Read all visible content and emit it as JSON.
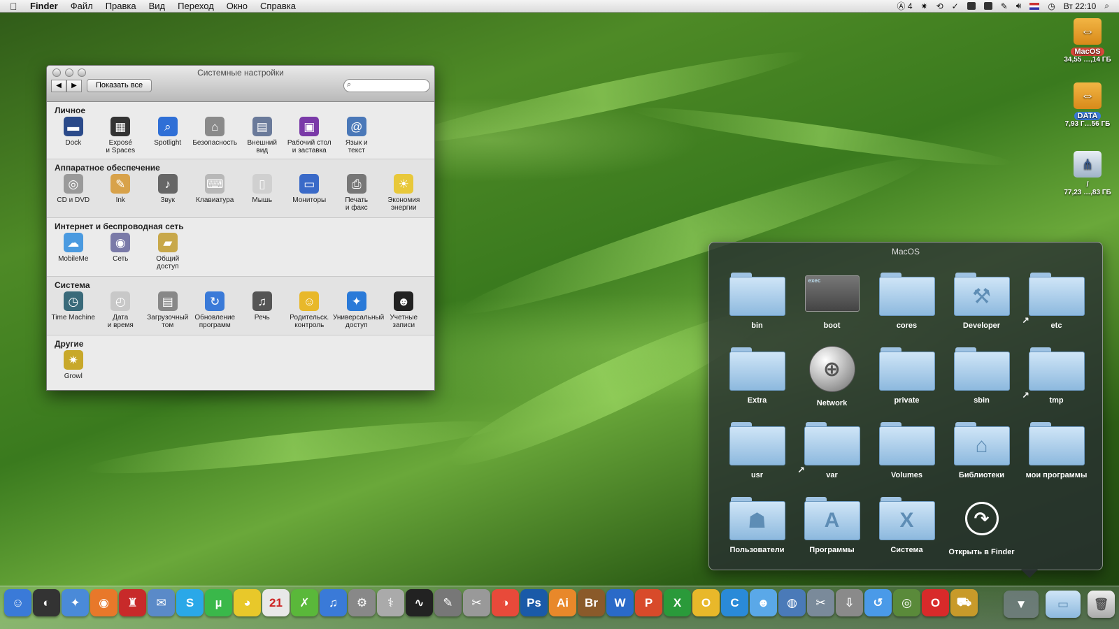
{
  "menubar": {
    "app": "Finder",
    "items": [
      "Файл",
      "Правка",
      "Вид",
      "Переход",
      "Окно",
      "Справка"
    ],
    "status_text": "4",
    "clock": "Вт 22:10"
  },
  "prefs": {
    "title": "Системные настройки",
    "show_all": "Показать все",
    "sections": [
      {
        "title": "Личное",
        "items": [
          {
            "label": "Dock",
            "icon": "dock-icon",
            "color": "#2b4a8a",
            "glyph": "▬"
          },
          {
            "label": "Exposé\nи Spaces",
            "icon": "expose-icon",
            "color": "#333333",
            "glyph": "▦"
          },
          {
            "label": "Spotlight",
            "icon": "spotlight-icon",
            "color": "#2f6fd6",
            "glyph": "⌕"
          },
          {
            "label": "Безопасность",
            "icon": "security-icon",
            "color": "#8a8a8a",
            "glyph": "⌂"
          },
          {
            "label": "Внешний\nвид",
            "icon": "appearance-icon",
            "color": "#6a7a9a",
            "glyph": "▤"
          },
          {
            "label": "Рабочий стол\nи заставка",
            "icon": "desktop-icon",
            "color": "#7a3aa8",
            "glyph": "▣"
          },
          {
            "label": "Язык и\nтекст",
            "icon": "language-icon",
            "color": "#4a78b8",
            "glyph": "@"
          }
        ]
      },
      {
        "title": "Аппаратное обеспечение",
        "items": [
          {
            "label": "CD и DVD",
            "icon": "cd-icon",
            "color": "#9a9a9a",
            "glyph": "◎"
          },
          {
            "label": "Ink",
            "icon": "ink-icon",
            "color": "#d8a24a",
            "glyph": "✎"
          },
          {
            "label": "Звук",
            "icon": "sound-icon",
            "color": "#666666",
            "glyph": "♪"
          },
          {
            "label": "Клавиатура",
            "icon": "keyboard-icon",
            "color": "#b8b8b8",
            "glyph": "⌨"
          },
          {
            "label": "Мышь",
            "icon": "mouse-icon",
            "color": "#d0d0d0",
            "glyph": "▯"
          },
          {
            "label": "Мониторы",
            "icon": "displays-icon",
            "color": "#3a6ac8",
            "glyph": "▭"
          },
          {
            "label": "Печать\nи факс",
            "icon": "print-icon",
            "color": "#777777",
            "glyph": "⎙"
          },
          {
            "label": "Экономия\nэнергии",
            "icon": "energy-icon",
            "color": "#e8c83a",
            "glyph": "☀"
          }
        ]
      },
      {
        "title": "Интернет и беспроводная сеть",
        "items": [
          {
            "label": "MobileMe",
            "icon": "mobileme-icon",
            "color": "#4a9ae0",
            "glyph": "☁"
          },
          {
            "label": "Сеть",
            "icon": "network-icon",
            "color": "#7a7aa8",
            "glyph": "◉"
          },
          {
            "label": "Общий\nдоступ",
            "icon": "sharing-icon",
            "color": "#c8a84a",
            "glyph": "▰"
          }
        ]
      },
      {
        "title": "Система",
        "items": [
          {
            "label": "Time Machine",
            "icon": "timemachine-icon",
            "color": "#3a6a7a",
            "glyph": "◷"
          },
          {
            "label": "Дата\nи время",
            "icon": "datetime-icon",
            "color": "#c8c8c8",
            "glyph": "◴"
          },
          {
            "label": "Загрузочный\nтом",
            "icon": "startup-icon",
            "color": "#888888",
            "glyph": "▤"
          },
          {
            "label": "Обновление\nпрограмм",
            "icon": "update-icon",
            "color": "#3a7ad8",
            "glyph": "↻"
          },
          {
            "label": "Речь",
            "icon": "speech-icon",
            "color": "#555555",
            "glyph": "♫"
          },
          {
            "label": "Родительск.\nконтроль",
            "icon": "parental-icon",
            "color": "#e8b82a",
            "glyph": "☺"
          },
          {
            "label": "Универсальный\nдоступ",
            "icon": "accessibility-icon",
            "color": "#2a7ad8",
            "glyph": "✦"
          },
          {
            "label": "Учетные\nзаписи",
            "icon": "accounts-icon",
            "color": "#222222",
            "glyph": "☻"
          }
        ]
      },
      {
        "title": "Другие",
        "items": [
          {
            "label": "Growl",
            "icon": "growl-icon",
            "color": "#c8a82a",
            "glyph": "✷"
          }
        ]
      }
    ]
  },
  "stack": {
    "title": "MacOS",
    "items": [
      {
        "label": "bin",
        "kind": "folder"
      },
      {
        "label": "boot",
        "kind": "exec"
      },
      {
        "label": "cores",
        "kind": "folder"
      },
      {
        "label": "Developer",
        "kind": "folder",
        "glyph": "⚒"
      },
      {
        "label": "etc",
        "kind": "folder",
        "alias": true
      },
      {
        "label": "Extra",
        "kind": "folder"
      },
      {
        "label": "Network",
        "kind": "globe"
      },
      {
        "label": "private",
        "kind": "folder"
      },
      {
        "label": "sbin",
        "kind": "folder"
      },
      {
        "label": "tmp",
        "kind": "folder",
        "alias": true
      },
      {
        "label": "usr",
        "kind": "folder"
      },
      {
        "label": "var",
        "kind": "folder",
        "alias": true
      },
      {
        "label": "Volumes",
        "kind": "folder"
      },
      {
        "label": "Библиотеки",
        "kind": "folder",
        "glyph": "⌂"
      },
      {
        "label": "мои программы",
        "kind": "folder"
      },
      {
        "label": "Пользователи",
        "kind": "folder",
        "glyph": "☗"
      },
      {
        "label": "Программы",
        "kind": "folder",
        "glyph": "A"
      },
      {
        "label": "Система",
        "kind": "folder",
        "glyph": "X"
      },
      {
        "label": "Открыть в Finder",
        "kind": "open"
      }
    ],
    "exec_text": "exec"
  },
  "desktop": {
    "volumes": [
      {
        "name": "MacOS",
        "info": "34,55 …,14 ГБ",
        "badge_color": "#d8483a"
      },
      {
        "name": "DATA",
        "info": "7,93 Г…56 ГБ",
        "badge_color": "#3a7ad8"
      },
      {
        "name": "/",
        "info": "77,23 …,83 ГБ",
        "badge_color": ""
      }
    ]
  },
  "dock": {
    "items": [
      {
        "name": "finder",
        "glyph": "☺",
        "color": "#3a7ad8"
      },
      {
        "name": "dashboard",
        "glyph": "◐",
        "color": "#333333"
      },
      {
        "name": "safari",
        "glyph": "✦",
        "color": "#4a8ad8"
      },
      {
        "name": "firefox",
        "glyph": "◉",
        "color": "#e8782a"
      },
      {
        "name": "app-red",
        "glyph": "♜",
        "color": "#c82a2a"
      },
      {
        "name": "mail",
        "glyph": "✉",
        "color": "#5a8ac8"
      },
      {
        "name": "skype",
        "glyph": "S",
        "color": "#2aa8e8"
      },
      {
        "name": "utorrent",
        "glyph": "µ",
        "color": "#3ab84a"
      },
      {
        "name": "adium",
        "glyph": "◕",
        "color": "#e8c82a"
      },
      {
        "name": "ical",
        "glyph": "21",
        "color": "#e8e8e8"
      },
      {
        "name": "xcode-tool",
        "glyph": "✗",
        "color": "#5ab83a"
      },
      {
        "name": "itunes",
        "glyph": "♫",
        "color": "#3a7ad8"
      },
      {
        "name": "system-prefs",
        "glyph": "⚙",
        "color": "#888888"
      },
      {
        "name": "disk-utility",
        "glyph": "⚕",
        "color": "#aaaaaa"
      },
      {
        "name": "activity-monitor",
        "glyph": "∿",
        "color": "#222222"
      },
      {
        "name": "script-editor",
        "glyph": "✎",
        "color": "#777777"
      },
      {
        "name": "utilities",
        "glyph": "✂",
        "color": "#999999"
      },
      {
        "name": "picasa",
        "glyph": "◑",
        "color": "#e84a3a"
      },
      {
        "name": "photoshop",
        "glyph": "Ps",
        "color": "#1a5aa8"
      },
      {
        "name": "illustrator",
        "glyph": "Ai",
        "color": "#e8882a"
      },
      {
        "name": "bridge",
        "glyph": "Br",
        "color": "#8a5a2a"
      },
      {
        "name": "word",
        "glyph": "W",
        "color": "#2a6ac8"
      },
      {
        "name": "powerpoint",
        "glyph": "P",
        "color": "#d84a2a"
      },
      {
        "name": "excel",
        "glyph": "X",
        "color": "#2a9a3a"
      },
      {
        "name": "app-o",
        "glyph": "O",
        "color": "#e8b82a"
      },
      {
        "name": "app-c",
        "glyph": "C",
        "color": "#2a8ad8"
      },
      {
        "name": "app-people",
        "glyph": "☻",
        "color": "#5aa8e8"
      },
      {
        "name": "app-globe",
        "glyph": "◍",
        "color": "#4a7ab8"
      },
      {
        "name": "app-tools",
        "glyph": "✂",
        "color": "#7a8a9a"
      },
      {
        "name": "downloads-app",
        "glyph": "⇩",
        "color": "#8a8a8a"
      },
      {
        "name": "app-blue",
        "glyph": "↺",
        "color": "#4a9ae8"
      },
      {
        "name": "app-green",
        "glyph": "◎",
        "color": "#5a8a3a"
      },
      {
        "name": "opera",
        "glyph": "O",
        "color": "#d82a2a"
      },
      {
        "name": "forklift",
        "glyph": "⛟",
        "color": "#c89a2a"
      }
    ]
  }
}
